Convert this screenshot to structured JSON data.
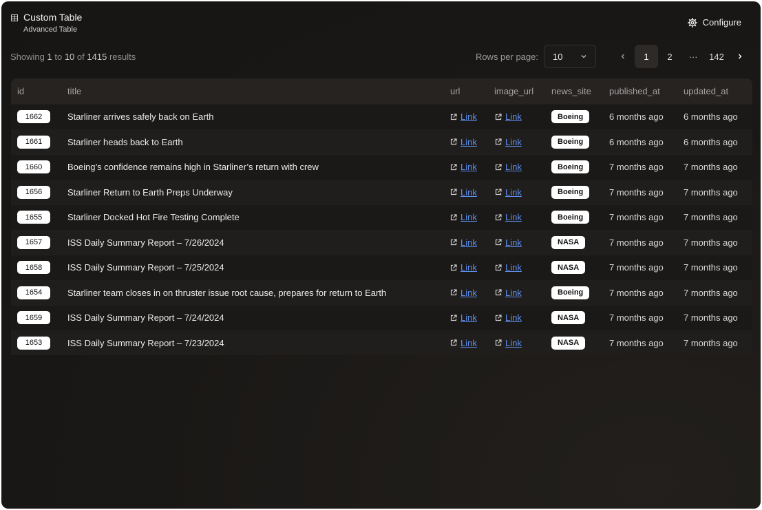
{
  "header": {
    "title": "Custom Table",
    "subtitle": "Advanced Table",
    "configure_label": "Configure"
  },
  "toolbar": {
    "showing_prefix": "Showing",
    "showing_from": "1",
    "showing_to_word": "to",
    "showing_to": "10",
    "showing_of_word": "of",
    "showing_total": "1415",
    "showing_suffix": "results",
    "rows_per_page_label": "Rows per page:",
    "rows_per_page_value": "10"
  },
  "pagination": {
    "pages": [
      "1",
      "2"
    ],
    "ellipsis": "···",
    "last_page": "142",
    "current": "1"
  },
  "table": {
    "columns": [
      "id",
      "title",
      "url",
      "image_url",
      "news_site",
      "published_at",
      "updated_at"
    ],
    "link_label": "Link",
    "rows": [
      {
        "id": "1662",
        "title": "Starliner arrives safely back on Earth",
        "news_site": "Boeing",
        "published_at": "6 months ago",
        "updated_at": "6 months ago"
      },
      {
        "id": "1661",
        "title": "Starliner heads back to Earth",
        "news_site": "Boeing",
        "published_at": "6 months ago",
        "updated_at": "6 months ago"
      },
      {
        "id": "1660",
        "title": "Boeing’s confidence remains high in Starliner’s return with crew",
        "news_site": "Boeing",
        "published_at": "7 months ago",
        "updated_at": "7 months ago"
      },
      {
        "id": "1656",
        "title": "Starliner Return to Earth Preps Underway",
        "news_site": "Boeing",
        "published_at": "7 months ago",
        "updated_at": "7 months ago"
      },
      {
        "id": "1655",
        "title": "Starliner Docked Hot Fire Testing Complete",
        "news_site": "Boeing",
        "published_at": "7 months ago",
        "updated_at": "7 months ago"
      },
      {
        "id": "1657",
        "title": "ISS Daily Summary Report – 7/26/2024",
        "news_site": "NASA",
        "published_at": "7 months ago",
        "updated_at": "7 months ago"
      },
      {
        "id": "1658",
        "title": "ISS Daily Summary Report – 7/25/2024",
        "news_site": "NASA",
        "published_at": "7 months ago",
        "updated_at": "7 months ago"
      },
      {
        "id": "1654",
        "title": "Starliner team closes in on thruster issue root cause, prepares for return to Earth",
        "news_site": "Boeing",
        "published_at": "7 months ago",
        "updated_at": "7 months ago"
      },
      {
        "id": "1659",
        "title": "ISS Daily Summary Report – 7/24/2024",
        "news_site": "NASA",
        "published_at": "7 months ago",
        "updated_at": "7 months ago"
      },
      {
        "id": "1653",
        "title": "ISS Daily Summary Report – 7/23/2024",
        "news_site": "NASA",
        "published_at": "7 months ago",
        "updated_at": "7 months ago"
      }
    ]
  },
  "colors": {
    "background": "#1a1816",
    "link": "#5c8ff0",
    "badge_bg": "#ffffff"
  },
  "icons": {
    "table": "table-grid-icon",
    "configure": "gear-icon",
    "select": "chevron-down-icon",
    "prev": "chevron-left-icon",
    "next": "chevron-right-icon",
    "external": "external-link-icon"
  }
}
